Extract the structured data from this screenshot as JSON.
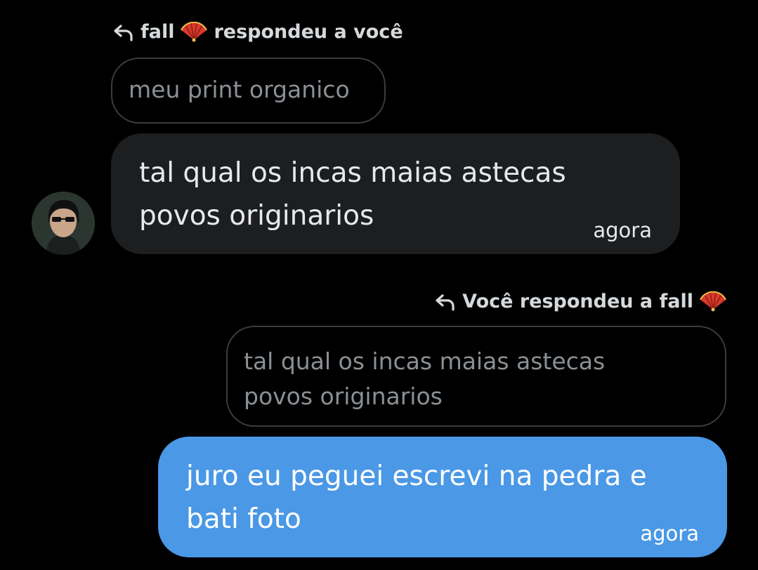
{
  "incoming": {
    "reply_header": {
      "prefix": "fall",
      "emoji_icon": "folding-fan-icon",
      "suffix": "respondeu a você"
    },
    "quoted_text": "meu print organico",
    "message_lines": [
      "tal qual os incas maias astecas",
      "povos originarios"
    ],
    "time": "agora",
    "avatar_icon": "user-avatar"
  },
  "outgoing": {
    "reply_header": {
      "prefix": "Você respondeu a fall",
      "emoji_icon": "folding-fan-icon"
    },
    "quoted_lines": [
      "tal qual os incas maias astecas",
      "povos originarios"
    ],
    "message_lines": [
      "juro eu peguei escrevi na pedra e",
      "bati foto"
    ],
    "time": "agora"
  },
  "colors": {
    "background": "#000000",
    "incoming_bubble": "#1d1e20",
    "outgoing_bubble": "#4a98e6",
    "quoted_border": "#3a3d40",
    "quoted_text": "#8b9095"
  }
}
